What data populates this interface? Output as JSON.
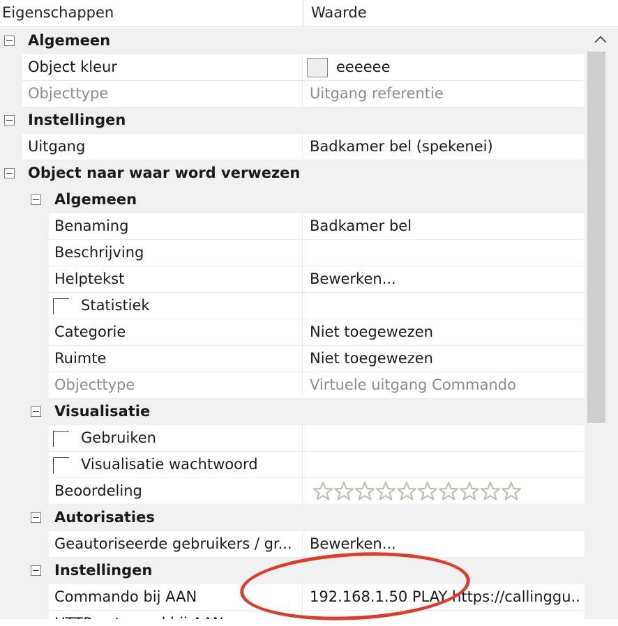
{
  "header": {
    "col_properties": "Eigenschappen",
    "col_value": "Waarde"
  },
  "rows": [
    {
      "kind": "cat",
      "level": 0,
      "name": "Algemeen"
    },
    {
      "kind": "prop",
      "level": 0,
      "name": "Object kleur",
      "value": "eeeeee",
      "swatch": "#eeeeee"
    },
    {
      "kind": "prop",
      "level": 0,
      "name": "Objecttype",
      "value": "Uitgang referentie",
      "readonly": true
    },
    {
      "kind": "cat",
      "level": 0,
      "name": "Instellingen"
    },
    {
      "kind": "prop",
      "level": 0,
      "name": "Uitgang",
      "value": "Badkamer bel (spekenei)"
    },
    {
      "kind": "cat",
      "level": 0,
      "name": "Object naar waar word verwezen"
    },
    {
      "kind": "cat",
      "level": 1,
      "name": "Algemeen"
    },
    {
      "kind": "prop",
      "level": 1,
      "name": "Benaming",
      "value": "Badkamer bel"
    },
    {
      "kind": "prop",
      "level": 1,
      "name": "Beschrijving",
      "value": ""
    },
    {
      "kind": "prop",
      "level": 1,
      "name": "Helptekst",
      "value": "Bewerken..."
    },
    {
      "kind": "check",
      "level": 1,
      "name": "Statistiek",
      "value": ""
    },
    {
      "kind": "prop",
      "level": 1,
      "name": "Categorie",
      "value": "Niet toegewezen"
    },
    {
      "kind": "prop",
      "level": 1,
      "name": "Ruimte",
      "value": "Niet toegewezen"
    },
    {
      "kind": "prop",
      "level": 1,
      "name": "Objecttype",
      "value": "Virtuele uitgang Commando",
      "readonly": true
    },
    {
      "kind": "cat",
      "level": 1,
      "name": "Visualisatie"
    },
    {
      "kind": "check",
      "level": 1,
      "name": "Gebruiken",
      "value": ""
    },
    {
      "kind": "check",
      "level": 1,
      "name": "Visualisatie wachtwoord",
      "value": ""
    },
    {
      "kind": "rating",
      "level": 1,
      "name": "Beoordeling",
      "stars": 10,
      "rating": 0
    },
    {
      "kind": "cat",
      "level": 1,
      "name": "Autorisaties"
    },
    {
      "kind": "prop",
      "level": 1,
      "name": "Geautoriseerde gebruikers / gr...",
      "value": "Bewerken..."
    },
    {
      "kind": "cat",
      "level": 1,
      "name": "Instellingen"
    },
    {
      "kind": "prop",
      "level": 1,
      "name": "Commando bij AAN",
      "value": "192.168.1.50 PLAY https://callinggu..."
    },
    {
      "kind": "prop",
      "level": 1,
      "name": "HTTP antwoord bij AAN",
      "value": ""
    }
  ],
  "annotation": {
    "color": "#e03a2a"
  },
  "colors": {
    "gutter": "#f0f0f0",
    "readonly_text": "#8c8c8c",
    "star": "#bdbdb0"
  }
}
